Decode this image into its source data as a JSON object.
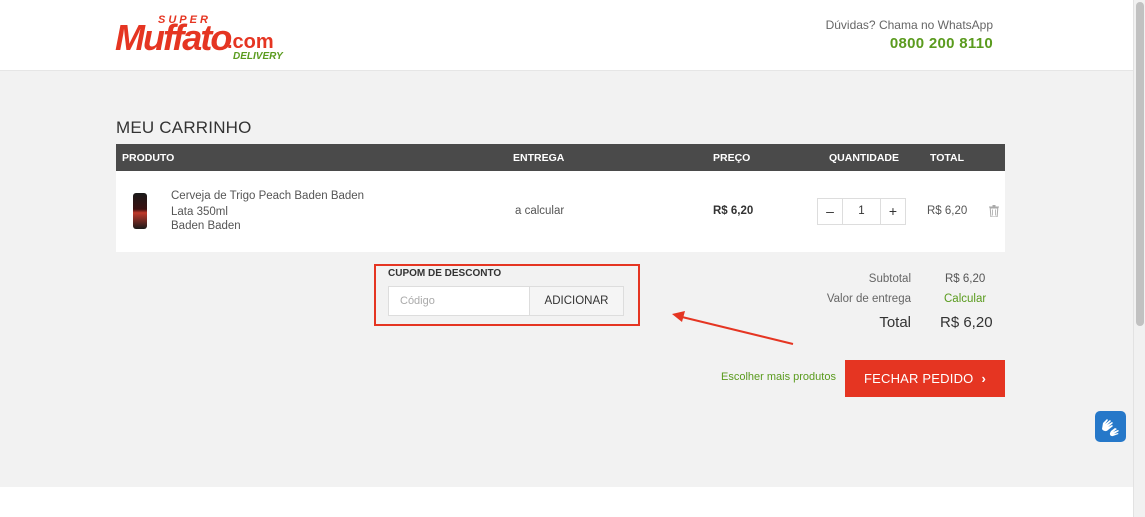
{
  "header": {
    "logo": {
      "super": "SUPER",
      "main": "Muffato",
      "com": ".com",
      "delivery": "DELIVERY"
    },
    "help_text": "Dúvidas? Chama no WhatsApp",
    "phone": "0800 200 8110"
  },
  "cart": {
    "title": "MEU CARRINHO",
    "columns": {
      "product": "PRODUTO",
      "delivery": "ENTREGA",
      "price": "PREÇO",
      "quantity": "QUANTIDADE",
      "total": "TOTAL"
    },
    "items": [
      {
        "name": "Cerveja de Trigo Peach Baden Baden Lata 350ml",
        "brand": "Baden Baden",
        "delivery": "a calcular",
        "price": "R$ 6,20",
        "quantity": "1",
        "total": "R$ 6,20"
      }
    ]
  },
  "coupon": {
    "label": "CUPOM DE DESCONTO",
    "placeholder": "Código",
    "button": "ADICIONAR"
  },
  "summary": {
    "subtotal_label": "Subtotal",
    "subtotal_value": "R$ 6,20",
    "delivery_label": "Valor de entrega",
    "delivery_value": "Calcular",
    "total_label": "Total",
    "total_value": "R$ 6,20"
  },
  "actions": {
    "more_products": "Escolher mais produtos",
    "checkout": "FECHAR PEDIDO"
  },
  "colors": {
    "brand_red": "#e53522",
    "brand_green": "#5a9b1e",
    "table_header": "#4a4a4a",
    "accessibility_blue": "#2678c9"
  },
  "icons": [
    "trash-icon",
    "chevron-right-icon",
    "hand-sign-language-icon",
    "annotation-arrow"
  ]
}
